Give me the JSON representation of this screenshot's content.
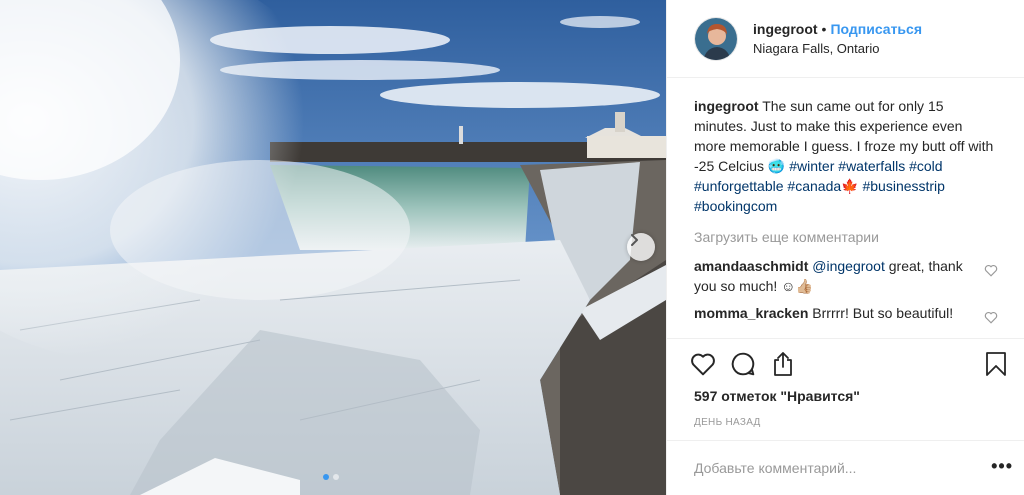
{
  "header": {
    "username": "ingegroot",
    "separator": "•",
    "follow_label": "Подписаться",
    "location": "Niagara Falls, Ontario"
  },
  "caption": {
    "username": "ingegroot",
    "text": "The sun came out for only 15 minutes. Just to make this experience even more memorable I guess. I froze my butt off with -25 Celcius 🥶",
    "hashtags": [
      "#winter",
      "#waterfalls",
      "#cold",
      "#unforgettable",
      "#canada",
      "#businesstrip",
      "#bookingcom"
    ],
    "flag_emoji": "🍁"
  },
  "load_more_label": "Загрузить еще комментарии",
  "comments": [
    {
      "username": "amandaaschmidt",
      "mention": "@ingegroot",
      "text": "great, thank you so much! ☺👍🏼"
    },
    {
      "username": "momma_kracken",
      "mention": "",
      "text": "Brrrrr! But so beautiful!"
    }
  ],
  "likes_label": "597 отметок \"Нравится\"",
  "date_label": "день назад",
  "add_comment_placeholder": "Добавьте комментарий...",
  "more_label": "•••",
  "carousel": {
    "slides": 2,
    "active": 0
  },
  "colors": {
    "link": "#3897f0",
    "hashtag": "#003569",
    "muted": "#999999",
    "border": "#efefef"
  },
  "icons": [
    "next-arrow-icon",
    "heart-icon",
    "comment-icon",
    "share-icon",
    "bookmark-icon",
    "small-heart-icon",
    "more-options-icon"
  ]
}
